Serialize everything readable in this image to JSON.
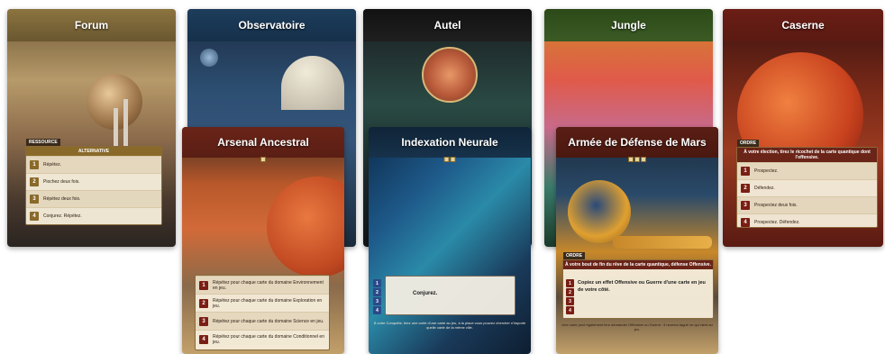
{
  "top_cards": [
    {
      "title": "Forum"
    },
    {
      "title": "Observatoire"
    },
    {
      "title": "Autel"
    },
    {
      "title": "Jungle"
    },
    {
      "title": "Caserne"
    }
  ],
  "forum_panel": {
    "tag": "RESSOURCE",
    "header": "ALTERNATIVE",
    "rows": [
      {
        "num": "1",
        "text": "Répétez."
      },
      {
        "num": "2",
        "text": "Piochez deux fois."
      },
      {
        "num": "3",
        "text": "Répétez deux fois."
      },
      {
        "num": "4",
        "text": "Conjurez. Répétez."
      }
    ]
  },
  "caserne_panel": {
    "tag": "ORDRE",
    "header": "À votre élection, tirez le ricochet de la carte quantique dont l'offensive.",
    "rows": [
      {
        "num": "1",
        "text": "Prospectez."
      },
      {
        "num": "2",
        "text": "Défendez."
      },
      {
        "num": "3",
        "text": "Prospectez deux fois."
      },
      {
        "num": "4",
        "text": "Prospectez. Défendez."
      }
    ]
  },
  "arsenal": {
    "title": "Arsenal Ancestral",
    "rows": [
      {
        "num": "1",
        "text": "Répétez pour chaque carte du domaine Environnement en jeu."
      },
      {
        "num": "2",
        "text": "Répétez pour chaque carte du domaine Exploration en jeu."
      },
      {
        "num": "3",
        "text": "Répétez pour chaque carte du domaine Science en jeu."
      },
      {
        "num": "4",
        "text": "Répétez pour chaque carte du domaine Conditionnel en jeu."
      }
    ]
  },
  "indexation": {
    "title": "Indexation Neurale",
    "nums": [
      "1",
      "2",
      "3",
      "4"
    ],
    "main_text": "Conjurez.",
    "footnote": "À votre Conquête, tirez une carte d'une carte au jeu, à la place vous pouvez chercher n'importe quelle carte de la même ville."
  },
  "armee": {
    "title": "Armée de Défense de Mars",
    "tag": "ORDRE",
    "header": "À votre bout de fin du rêve de la carte quantique, défense Offensive.",
    "nums": [
      "1",
      "2",
      "3",
      "4"
    ],
    "main_text": "Copiez un effet Offensive ou Guerre d'une carte en jeu de votre côté.",
    "footnote": "Une carte peut également leur demander Offensive ou Guerre : il recevra tagué ce qui vient au jeu."
  },
  "colors": {
    "panel_bg": "#f5ecda",
    "red_badge": "#7a1e14",
    "gold_badge": "#8a6a2a",
    "blue_badge": "#2a4a8a"
  }
}
